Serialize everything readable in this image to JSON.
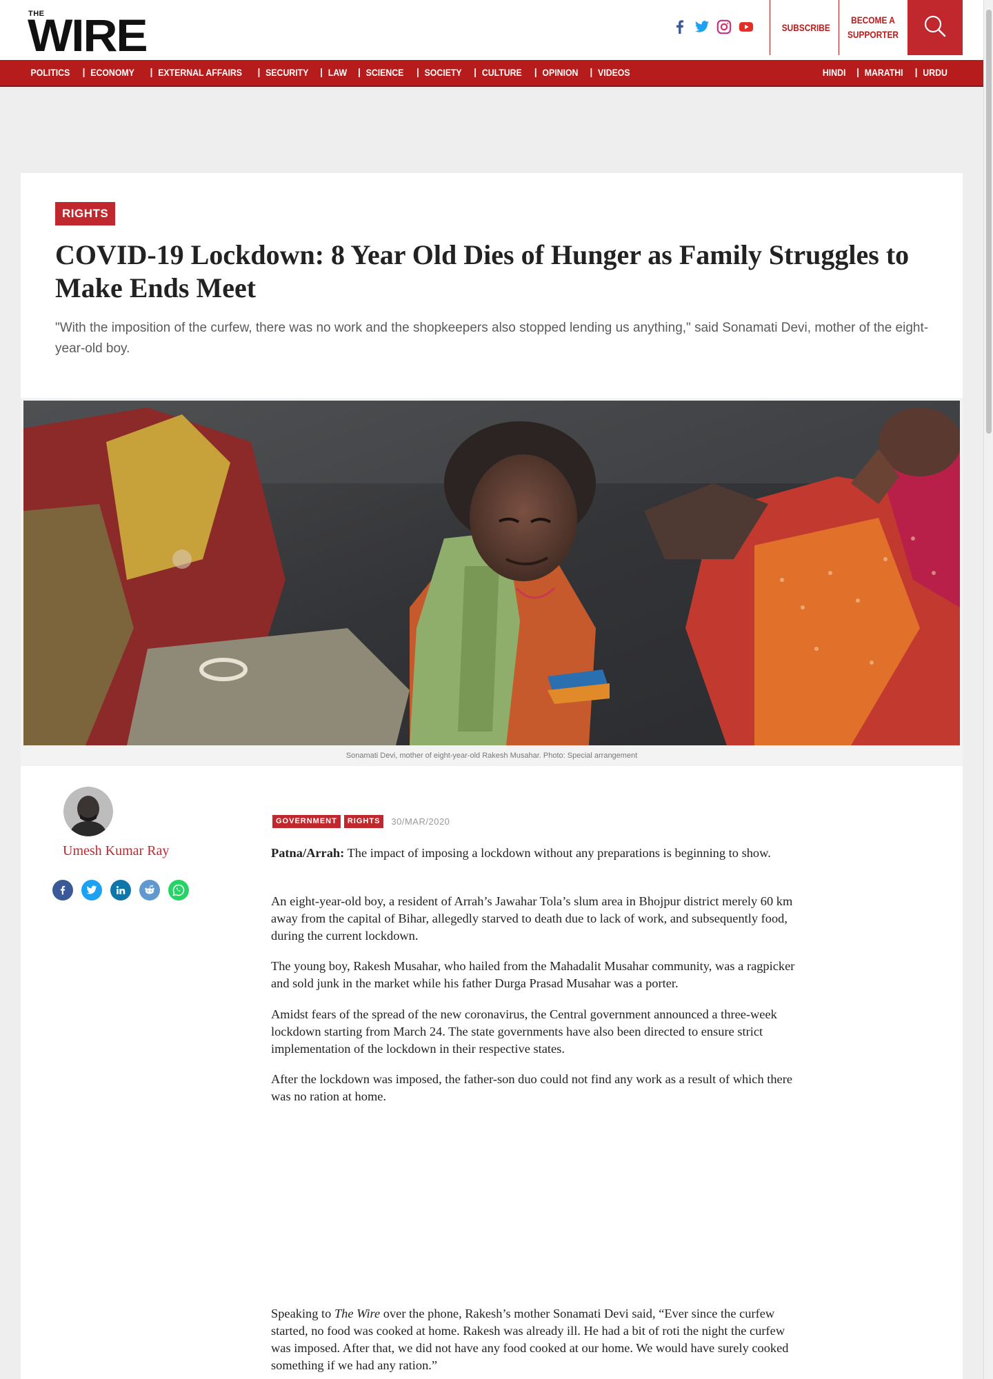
{
  "header": {
    "logo_small": "THE",
    "logo_big": "WIRE",
    "subscribe_label": "SUBSCRIBE",
    "supporter_line1": "BECOME A",
    "supporter_line2": "SUPPORTER",
    "socials": [
      "facebook-icon",
      "twitter-icon",
      "instagram-icon",
      "youtube-icon"
    ]
  },
  "nav": {
    "items": [
      "POLITICS",
      "ECONOMY",
      "EXTERNAL AFFAIRS",
      "SECURITY",
      "LAW",
      "SCIENCE",
      "SOCIETY",
      "CULTURE",
      "OPINION",
      "VIDEOS"
    ],
    "languages": [
      "HINDI",
      "MARATHI",
      "URDU"
    ]
  },
  "colors": {
    "brand_red": "#c0282d",
    "nav_red": "#b71c1c"
  },
  "article": {
    "category": "RIGHTS",
    "headline": "COVID-19 Lockdown: 8 Year Old Dies of Hunger as Family Struggles to Make Ends Meet",
    "standfirst": "\"With the imposition of the curfew, there was no work and the shopkeepers also stopped lending us anything,\" said Sonamati Devi, mother of the eight-year-old boy.",
    "image_caption": "Sonamati Devi, mother of eight-year-old Rakesh Musahar. Photo: Special arrangement",
    "author": "Umesh Kumar Ray",
    "share": [
      "facebook-icon",
      "twitter-icon",
      "linkedin-icon",
      "reddit-icon",
      "whatsapp-icon"
    ],
    "tags": [
      "GOVERNMENT",
      "RIGHTS"
    ],
    "date": "30/MAR/2020",
    "dateline": "Patna/Arrah:",
    "p1": " The impact of imposing a lockdown without any preparations is beginning to show.",
    "p2": "An eight-year-old boy, a resident of Arrah’s Jawahar Tola’s slum area in Bhojpur district merely 60 km away from the capital of Bihar, allegedly starved to death due to lack of work, and subsequently food, during the current lockdown.",
    "p3": "The young boy, Rakesh Musahar, who hailed from the Mahadalit Musahar community, was a ragpicker and sold junk in the market while his father Durga Prasad Musahar was a porter.",
    "p4": "Amidst fears of the spread of the new coronavirus, the Central government announced a three-week lockdown starting from March 24. The state governments have also been directed to ensure strict implementation of the lockdown in their respective states.",
    "p5": "After the lockdown was imposed, the father-son duo could not find any work as a result of which there was no ration at home.",
    "p6_a": "Speaking to ",
    "p6_b": "The Wire",
    "p6_c": " over the phone, Rakesh’s mother Sonamati Devi said, “Ever since the curfew started, no food was cooked at home. Rakesh was already ill. He had a bit of roti the night the curfew was imposed. After that, we did not have any food cooked at our home. We would have surely cooked something if we had any ration.”"
  }
}
